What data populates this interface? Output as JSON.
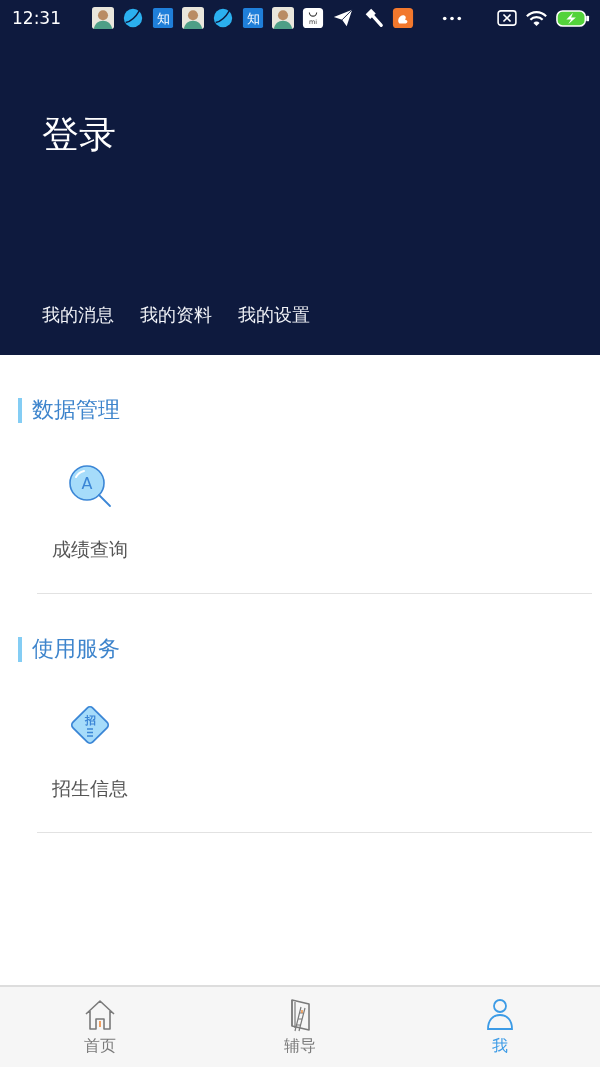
{
  "status_bar": {
    "time": "12:31",
    "notifications": [
      {
        "kind": "avatar"
      },
      {
        "kind": "orb"
      },
      {
        "kind": "text-tile",
        "label": "知"
      },
      {
        "kind": "avatar"
      },
      {
        "kind": "orb"
      },
      {
        "kind": "text-tile",
        "label": "知"
      },
      {
        "kind": "avatar"
      },
      {
        "kind": "bag",
        "label": "mi"
      },
      {
        "kind": "plane"
      },
      {
        "kind": "hammer"
      },
      {
        "kind": "app-tile"
      }
    ]
  },
  "header": {
    "title": "登录",
    "links": [
      "我的消息",
      "我的资料",
      "我的设置"
    ]
  },
  "sections": [
    {
      "title": "数据管理",
      "items": [
        {
          "label": "成绩查询",
          "icon": {
            "kind": "search",
            "text": "A"
          }
        }
      ]
    },
    {
      "title": "使用服务",
      "items": [
        {
          "label": "招生信息",
          "icon": {
            "kind": "diamond",
            "text": "招"
          }
        }
      ]
    }
  ],
  "tab_bar": [
    {
      "kind": "home",
      "label": "首页",
      "selected": false
    },
    {
      "kind": "book",
      "label": "辅导",
      "selected": false
    },
    {
      "kind": "person",
      "label": "我",
      "selected": true
    }
  ]
}
